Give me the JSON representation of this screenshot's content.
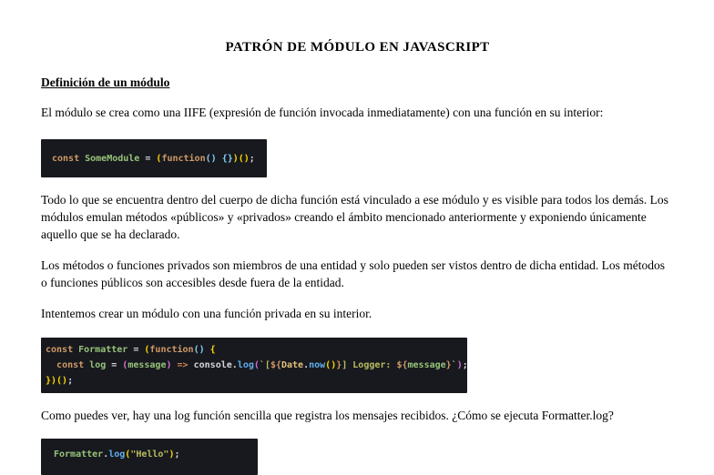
{
  "page": {
    "title": "PATRÓN DE MÓDULO EN JAVASCRIPT",
    "section_heading": "Definición de un módulo",
    "paragraphs": {
      "p1": "El módulo se crea como una IIFE (expresión de función invocada inmediatamente) con una función en su interior:",
      "p2": "Todo lo que se encuentra dentro del cuerpo de dicha función está vinculado a ese módulo y es visible para todos los demás. Los módulos emulan métodos «públicos» y «privados» creando el ámbito mencionado anteriormente y exponiendo únicamente aquello que se ha declarado.",
      "p3": "Los métodos o funciones privados son miembros de una entidad y solo pueden ser vistos dentro de dicha entidad. Los métodos o funciones públicos son accesibles desde fuera de la entidad.",
      "p4": "Intentemos crear un módulo con una función privada en su interior.",
      "p5": "Como puedes ver, hay una log función sencilla que registra los mensajes recibidos. ¿Cómo se ejecuta Formatter.log?"
    },
    "colors": {
      "code_background": "#17191e",
      "keyword": "#d19a66",
      "identifier": "#98c379",
      "string": "#b8bd5f",
      "builtin_class": "#e5c07b",
      "method": "#61afef",
      "bracket_gold": "#ffd700",
      "bracket_blue": "#87cefa",
      "bracket_orchid": "#da70d6"
    },
    "code_blocks": [
      {
        "plain_text": "const SomeModule = (function() {})();",
        "lines": [
          [
            [
              "kw",
              "const "
            ],
            [
              "id",
              "SomeModule"
            ],
            [
              "pn",
              " = "
            ],
            [
              "b1",
              "("
            ],
            [
              "kw",
              "function"
            ],
            [
              "b2",
              "()"
            ],
            [
              "pn",
              " "
            ],
            [
              "b2",
              "{}"
            ],
            [
              "b1",
              ")()"
            ],
            [
              "pn",
              ";"
            ]
          ]
        ]
      },
      {
        "plain_text": "const Formatter = (function() {\n  const log = (message) => console.log(`[${Date.now()}] Logger: ${message}`);\n})();",
        "lines": [
          [
            [
              "kw",
              "const "
            ],
            [
              "id",
              "Formatter"
            ],
            [
              "pn",
              " = "
            ],
            [
              "b1",
              "("
            ],
            [
              "kw",
              "function"
            ],
            [
              "b2",
              "()"
            ],
            [
              "pn",
              " "
            ],
            [
              "b1",
              "{"
            ]
          ],
          [
            [
              "pn",
              "  "
            ],
            [
              "kw",
              "const "
            ],
            [
              "id",
              "log"
            ],
            [
              "pn",
              " = "
            ],
            [
              "b3",
              "("
            ],
            [
              "id",
              "message"
            ],
            [
              "b3",
              ")"
            ],
            [
              "arrow",
              " => "
            ],
            [
              "pn",
              "console"
            ],
            [
              "pn",
              "."
            ],
            [
              "fn",
              "log"
            ],
            [
              "b3",
              "("
            ],
            [
              "str",
              "`["
            ],
            [
              "interp",
              "${"
            ],
            [
              "cls",
              "Date"
            ],
            [
              "pn",
              "."
            ],
            [
              "fn",
              "now"
            ],
            [
              "b1",
              "()"
            ],
            [
              "interp",
              "}"
            ],
            [
              "str",
              "] Logger: "
            ],
            [
              "interp",
              "${"
            ],
            [
              "id",
              "message"
            ],
            [
              "interp",
              "}"
            ],
            [
              "str",
              "`"
            ],
            [
              "b3",
              ")"
            ],
            [
              "pn",
              ";"
            ]
          ],
          [
            [
              "b1",
              "})()"
            ],
            [
              "pn",
              ";"
            ]
          ]
        ]
      },
      {
        "plain_text": "Formatter.log(\"Hello\");",
        "lines": [
          [
            [
              "id",
              "Formatter"
            ],
            [
              "pn",
              "."
            ],
            [
              "fn",
              "log"
            ],
            [
              "b1",
              "("
            ],
            [
              "str",
              "\"Hello\""
            ],
            [
              "b1",
              ")"
            ],
            [
              "pn",
              ";"
            ]
          ]
        ]
      }
    ]
  }
}
